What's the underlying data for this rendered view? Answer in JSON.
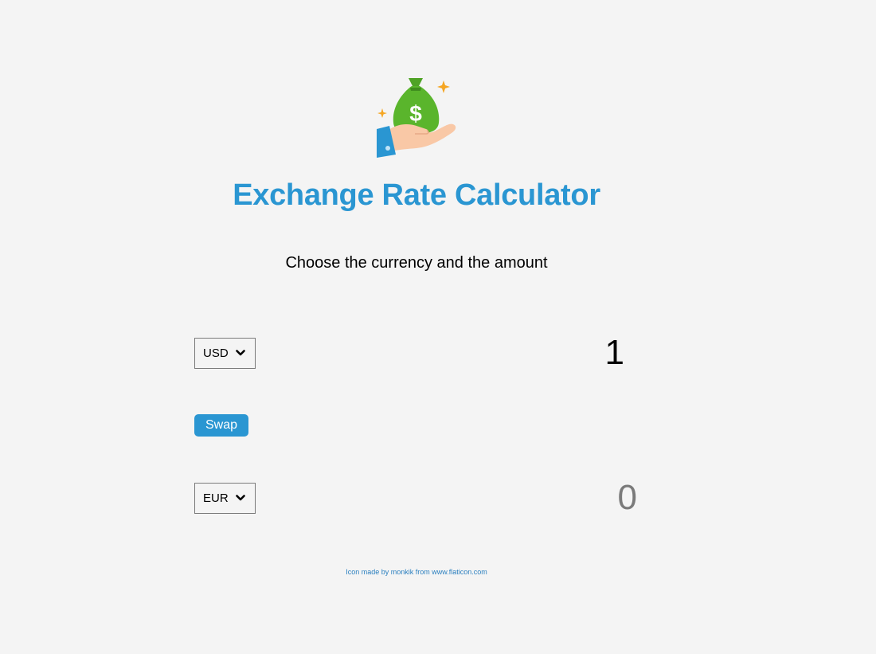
{
  "header": {
    "logo_icon": "money-bag-hand-icon",
    "title": "Exchange Rate Calculator",
    "subtitle": "Choose the currency and the amount"
  },
  "converter": {
    "from": {
      "currency": "USD",
      "amount": "1"
    },
    "swap_label": "Swap",
    "to": {
      "currency": "EUR",
      "amount": "0"
    }
  },
  "footer": {
    "credit_prefix": "Icon made by ",
    "credit_author": "monkik",
    "credit_middle": " from ",
    "credit_site": "www.flaticon.com"
  },
  "colors": {
    "accent": "#2a96d2",
    "background": "#f4f4f4",
    "bag": "#5ab52c",
    "sparkle": "#f5a623",
    "sleeve": "#2a96d2",
    "hand": "#f9c8a6"
  }
}
